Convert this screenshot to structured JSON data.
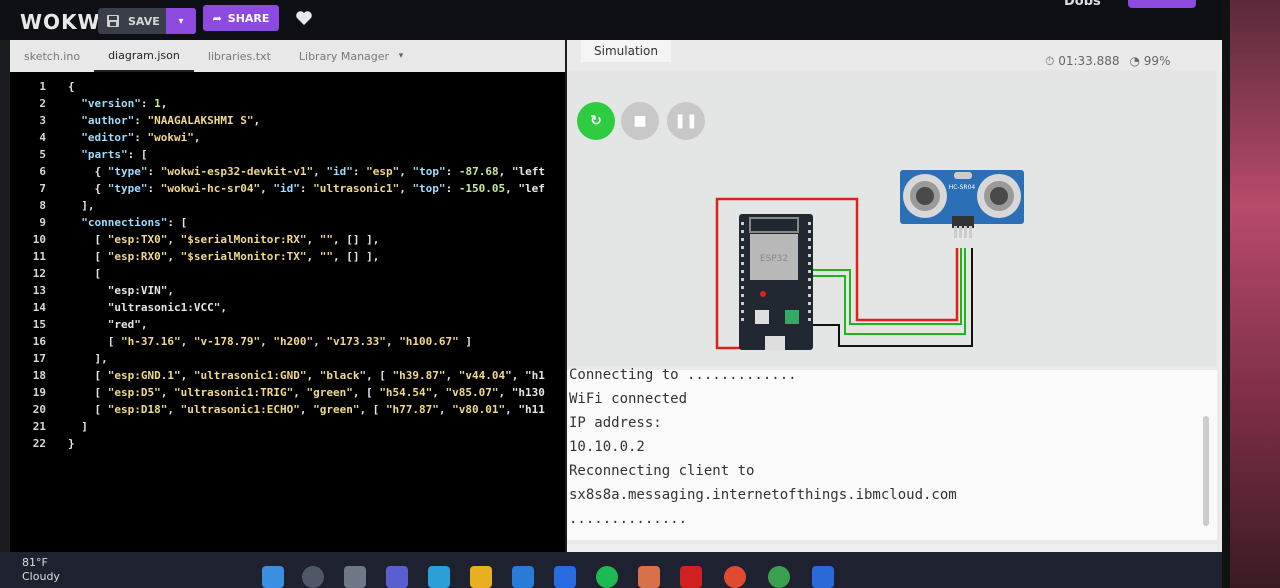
{
  "app": {
    "logo": "WOKWI",
    "user_partial": "Dobs"
  },
  "toolbar": {
    "save_label": "SAVE",
    "share_label": "SHARE"
  },
  "editor": {
    "tabs": [
      "sketch.ino",
      "diagram.json",
      "libraries.txt",
      "Library Manager"
    ],
    "active_tab": "diagram.json",
    "lines": [
      {
        "n": "1",
        "t": "{"
      },
      {
        "n": "2",
        "t": "  \"version\": 1,"
      },
      {
        "n": "3",
        "t": "  \"author\": \"NAAGALAKSHMI S\","
      },
      {
        "n": "4",
        "t": "  \"editor\": \"wokwi\","
      },
      {
        "n": "5",
        "t": "  \"parts\": ["
      },
      {
        "n": "6",
        "t": "    { \"type\": \"wokwi-esp32-devkit-v1\", \"id\": \"esp\", \"top\": -87.68, \"left"
      },
      {
        "n": "7",
        "t": "    { \"type\": \"wokwi-hc-sr04\", \"id\": \"ultrasonic1\", \"top\": -150.05, \"lef"
      },
      {
        "n": "8",
        "t": "  ],"
      },
      {
        "n": "9",
        "t": "  \"connections\": ["
      },
      {
        "n": "10",
        "t": "    [ \"esp:TX0\", \"$serialMonitor:RX\", \"\", [] ],"
      },
      {
        "n": "11",
        "t": "    [ \"esp:RX0\", \"$serialMonitor:TX\", \"\", [] ],"
      },
      {
        "n": "12",
        "t": "    ["
      },
      {
        "n": "13",
        "t": "      \"esp:VIN\","
      },
      {
        "n": "14",
        "t": "      \"ultrasonic1:VCC\","
      },
      {
        "n": "15",
        "t": "      \"red\","
      },
      {
        "n": "16",
        "t": "      [ \"h-37.16\", \"v-178.79\", \"h200\", \"v173.33\", \"h100.67\" ]"
      },
      {
        "n": "17",
        "t": "    ],"
      },
      {
        "n": "18",
        "t": "    [ \"esp:GND.1\", \"ultrasonic1:GND\", \"black\", [ \"h39.87\", \"v44.04\", \"h1"
      },
      {
        "n": "19",
        "t": "    [ \"esp:D5\", \"ultrasonic1:TRIG\", \"green\", [ \"h54.54\", \"v85.07\", \"h130"
      },
      {
        "n": "20",
        "t": "    [ \"esp:D18\", \"ultrasonic1:ECHO\", \"green\", [ \"h77.87\", \"v80.01\", \"h11"
      },
      {
        "n": "21",
        "t": "  ]"
      },
      {
        "n": "22",
        "t": "}"
      }
    ]
  },
  "simulation": {
    "tab_label": "Simulation",
    "timer": "01:33.888",
    "speed": "99%",
    "esp_label": "ESP32",
    "sensor_label": "HC-SR04",
    "serial_lines": [
      "Connecting to .............",
      "WiFi connected",
      "IP address:",
      "10.10.0.2",
      "Reconnecting client to",
      "sx8s8a.messaging.internetofthings.ibmcloud.com",
      ".............."
    ]
  },
  "taskbar": {
    "temp": "81°F",
    "condition": "Cloudy"
  },
  "colors": {
    "accent": "#8c4ae0",
    "play": "#2ecc40",
    "wire_red": "#e0201a",
    "wire_green": "#1fb51f"
  }
}
